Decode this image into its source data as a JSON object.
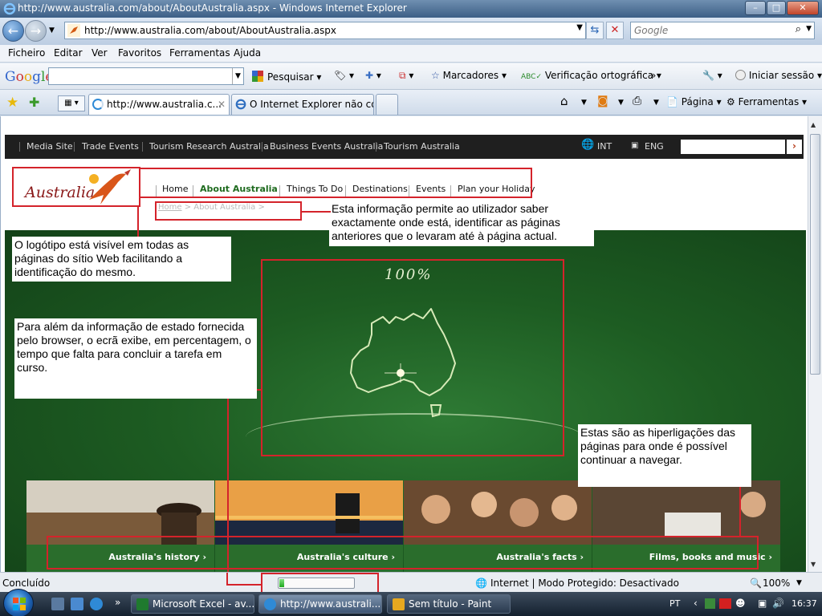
{
  "window": {
    "title": "http://www.australia.com/about/AboutAustralia.aspx - Windows Internet Explorer",
    "controls": {
      "minimize": "–",
      "maximize": "□",
      "close": "✕"
    }
  },
  "address": {
    "url": "http://www.australia.com/about/AboutAustralia.aspx",
    "search_placeholder": "Google"
  },
  "menu": [
    "Ficheiro",
    "Editar",
    "Ver",
    "Favoritos",
    "Ferramentas",
    "Ajuda"
  ],
  "google_toolbar": {
    "logo": "Google",
    "search": "Pesquisar",
    "bookmarks": "Marcadores",
    "spellcheck": "Verificação ortográfica",
    "more": "»",
    "signin": "Iniciar sessão"
  },
  "tabs": [
    {
      "label": "http://www.australia.c...",
      "close": "✕"
    },
    {
      "label": "O Internet Explorer não co..."
    }
  ],
  "commands": {
    "page": "Página",
    "tools": "Ferramentas"
  },
  "site": {
    "top_links": [
      "Media Site",
      "Trade Events",
      "Tourism Research Australia",
      "Business Events Australia",
      "Tourism Australia"
    ],
    "region": "INT",
    "language": "ENG",
    "search_go": "›",
    "logo_text": "Australia",
    "nav": [
      "Home",
      "About Australia",
      "Things To Do",
      "Destinations",
      "Events",
      "Plan your Holiday"
    ],
    "breadcrumb": {
      "home": "Home",
      "sep1": ">",
      "current": "About Australia",
      "sep2": ">"
    },
    "hero_text": "100%",
    "tiles": [
      "Australia's history  ›",
      "Australia's culture  ›",
      "Australia's facts  ›",
      "Films, books and music  ›"
    ]
  },
  "annotations": {
    "breadcrumb_note": "Esta informação permite ao utilizador saber exactamente onde está, identificar as páginas anteriores que o levaram até à página actual.",
    "logo_note": "O logótipo está visível em todas as páginas do sítio Web facilitando a identificação do mesmo.",
    "progress_note": "Para além da informação de estado fornecida pelo browser, o ecrã exibe, em percentagem, o tempo que falta para concluir a tarefa em curso.",
    "links_note": "Estas são as hiperligações das páginas para onde é possível continuar a navegar."
  },
  "status": {
    "text": "Concluído",
    "progress": 0.06,
    "zone": "Internet | Modo Protegido: Desactivado",
    "zoom": "100%",
    "zoom_dd": "▼"
  },
  "taskbar": {
    "more": "»",
    "buttons": [
      "Microsoft Excel - av...",
      "http://www.australi...",
      "Sem título - Paint"
    ],
    "lang": "PT",
    "tray_arrow": "‹",
    "clock": "16:37"
  },
  "colors": {
    "site_green": "#2a6d2c",
    "annotation_red": "#d4232b",
    "nav_active": "#1f6b1f"
  }
}
